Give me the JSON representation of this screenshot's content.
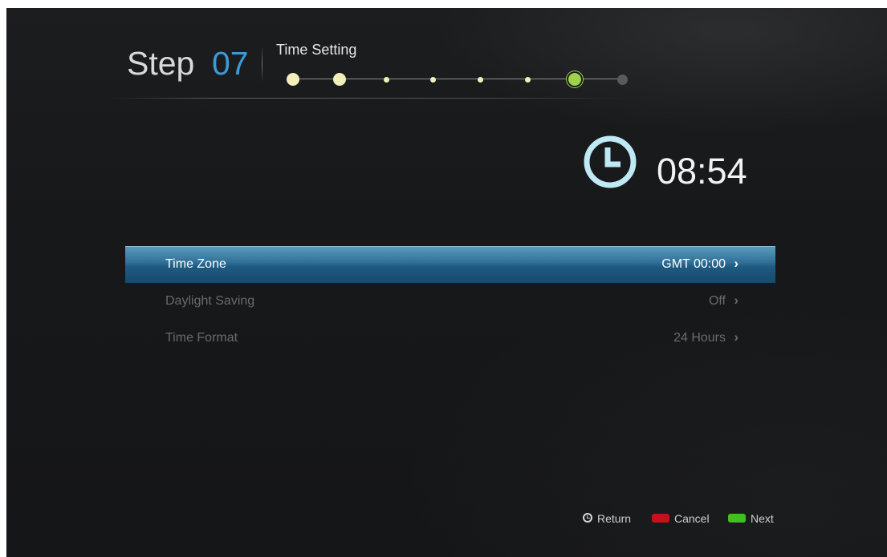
{
  "header": {
    "step_word": "Step",
    "step_number": "07",
    "step_title": "Time Setting",
    "progress": {
      "total_steps": 8,
      "current_step": 7,
      "colors": {
        "done": "#f3efb8",
        "current": "#9fd14a",
        "pending": "#5a5a5a"
      }
    }
  },
  "clock": {
    "icon": "clock-icon",
    "icon_color": "#bfe9f4",
    "time": "08:54"
  },
  "menu": {
    "items": [
      {
        "label": "Time Zone",
        "value": "GMT 00:00",
        "chevron": "›",
        "selected": true
      },
      {
        "label": "Daylight Saving",
        "value": "Off",
        "chevron": "›",
        "selected": false
      },
      {
        "label": "Time Format",
        "value": "24 Hours",
        "chevron": "›",
        "selected": false
      }
    ]
  },
  "footer": {
    "return_icon": "return-icon",
    "return_label": "Return",
    "cancel_label": "Cancel",
    "cancel_color": "#c8101a",
    "next_label": "Next",
    "next_color": "#3fc020"
  }
}
